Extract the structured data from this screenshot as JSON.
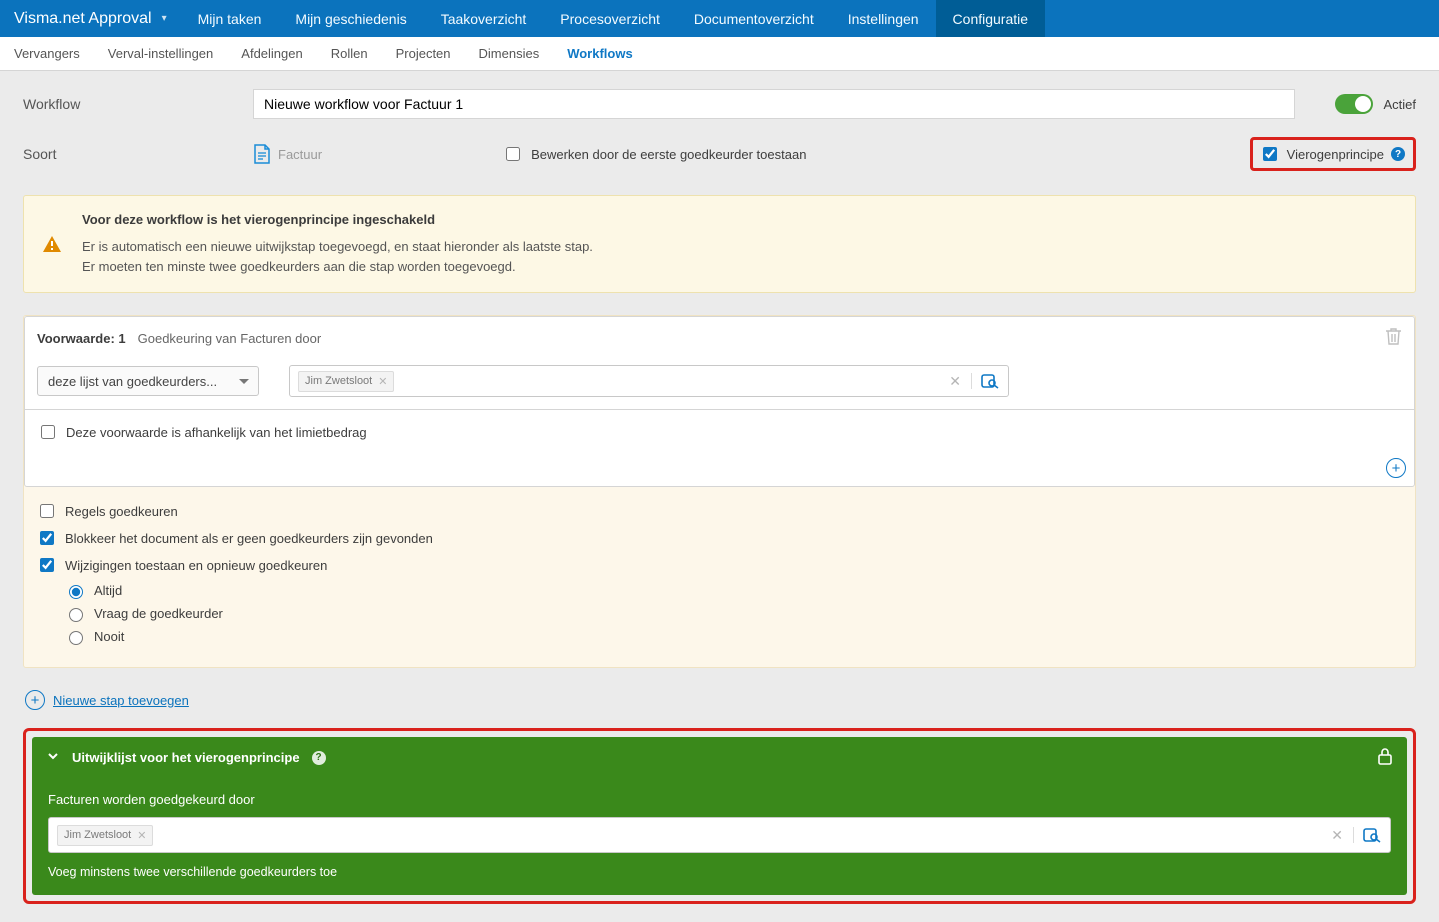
{
  "brand": "Visma.net Approval",
  "topnav": {
    "items": [
      "Mijn taken",
      "Mijn geschiedenis",
      "Taakoverzicht",
      "Procesoverzicht",
      "Documentoverzicht",
      "Instellingen",
      "Configuratie"
    ],
    "activeIndex": 6
  },
  "subnav": {
    "items": [
      "Vervangers",
      "Verval-instellingen",
      "Afdelingen",
      "Rollen",
      "Projecten",
      "Dimensies",
      "Workflows"
    ],
    "activeIndex": 6
  },
  "labels": {
    "workflow": "Workflow",
    "soort": "Soort",
    "kind": "Factuur",
    "edit_by_first": "Bewerken door de eerste goedkeurder toestaan",
    "four_eyes": "Vierogenprincipe",
    "active": "Actief"
  },
  "workflow_name": "Nieuwe workflow voor Factuur 1",
  "banner": {
    "title": "Voor deze workflow is het vierogenprincipe ingeschakeld",
    "line1": "Er is automatisch een nieuwe uitwijkstap toegevoegd, en staat hieronder als laatste stap.",
    "line2": "Er moeten ten minste twee goedkeurders aan die stap worden toegevoegd."
  },
  "condition": {
    "title": "Voorwaarde: 1",
    "subtitle": "Goedkeuring van Facturen door",
    "dropdown": "deze lijst van goedkeurders...",
    "approver": "Jim Zwetsloot",
    "depends_limit": "Deze voorwaarde is afhankelijk van het limietbedrag"
  },
  "options": {
    "approve_lines": "Regels goedkeuren",
    "block_no_approvers": "Blokkeer het document als er geen goedkeurders zijn gevonden",
    "allow_changes": "Wijzigingen toestaan en opnieuw goedkeuren",
    "radios": {
      "always": "Altijd",
      "ask": "Vraag de goedkeurder",
      "never": "Nooit"
    }
  },
  "add_step": "Nieuwe stap toevoegen",
  "fallback": {
    "title": "Uitwijklijst voor het vierogenprincipe",
    "subtitle": "Facturen worden goedgekeurd door",
    "approver": "Jim Zwetsloot",
    "hint": "Voeg minstens twee verschillende goedkeurders toe"
  }
}
